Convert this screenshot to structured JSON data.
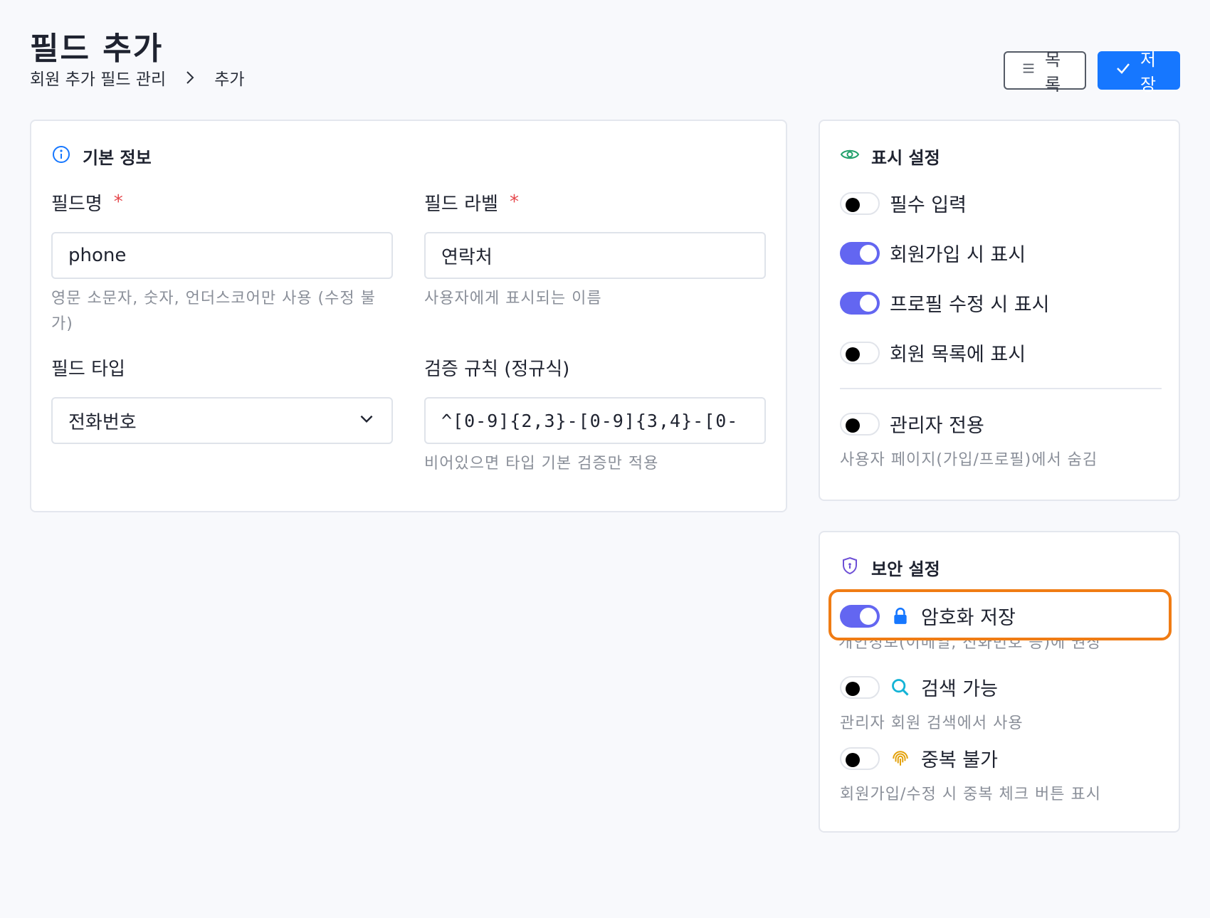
{
  "header": {
    "title": "필드 추가",
    "breadcrumb": [
      "회원 추가 필드 관리",
      "추가"
    ],
    "list_button": "목록",
    "save_button": "저장"
  },
  "basic": {
    "title": "기본 정보",
    "field_name": {
      "label": "필드명",
      "required": "*",
      "value": "phone",
      "help": "영문 소문자, 숫자, 언더스코어만 사용 (수정 불가)"
    },
    "field_label": {
      "label": "필드 라벨",
      "required": "*",
      "value": "연락처",
      "help": "사용자에게 표시되는 이름"
    },
    "field_type": {
      "label": "필드 타입",
      "value": "전화번호"
    },
    "validation": {
      "label": "검증 규칙 (정규식)",
      "value": "^[0-9]{2,3}-[0-9]{3,4}-[0-",
      "help": "비어있으면 타입 기본 검증만 적용"
    }
  },
  "display": {
    "title": "표시 설정",
    "toggles": [
      {
        "label": "필수 입력",
        "on": false
      },
      {
        "label": "회원가입 시 표시",
        "on": true
      },
      {
        "label": "프로필 수정 시 표시",
        "on": true
      },
      {
        "label": "회원 목록에 표시",
        "on": false
      }
    ],
    "admin_only": {
      "label": "관리자 전용",
      "on": false,
      "help": "사용자 페이지(가입/프로필)에서 숨김"
    }
  },
  "security": {
    "title": "보안 설정",
    "encrypt": {
      "label": "암호화 저장",
      "on": true,
      "icon": "lock-icon",
      "help": "개인정보(이메일, 전화번호 등)에 권장"
    },
    "searchable": {
      "label": "검색 가능",
      "on": false,
      "icon": "search-icon",
      "help": "관리자 회원 검색에서 사용"
    },
    "unique": {
      "label": "중복 불가",
      "on": false,
      "icon": "fingerprint-icon",
      "help": "회원가입/수정 시 중복 체크 버튼 표시"
    }
  },
  "colors": {
    "primary": "#1677ff",
    "toggle_on": "#6366f1",
    "required": "#e5484d",
    "highlight": "#f07c14"
  }
}
